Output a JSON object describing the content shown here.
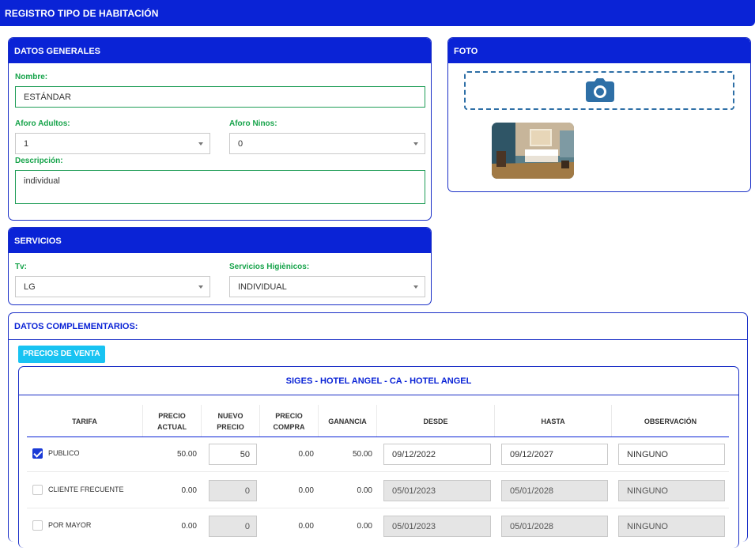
{
  "page_title": "REGISTRO TIPO DE HABITACIÓN",
  "datos_generales": {
    "title": "DATOS GENERALES",
    "nombre_label": "Nombre:",
    "nombre_value": "ESTÁNDAR",
    "aforo_adultos_label": "Aforo Adultos:",
    "aforo_adultos_value": "1",
    "aforo_ninos_label": "Aforo Ninos:",
    "aforo_ninos_value": "0",
    "descripcion_label": "Descripción:",
    "descripcion_value": "individual"
  },
  "foto": {
    "title": "FOTO",
    "upload_icon": "camera-icon",
    "thumbnail": "room-photo"
  },
  "servicios": {
    "title": "SERVICIOS",
    "tv_label": "Tv:",
    "tv_value": "LG",
    "higienicos_label": "Servicios Higiènicos:",
    "higienicos_value": "INDIVIDUAL"
  },
  "datos_complementarios": {
    "title": "DATOS COMPLEMENTARIOS:",
    "precios_button": "PRECIOS DE VENTA",
    "table_title": "SIGES - HOTEL ANGEL - CA - HOTEL ANGEL",
    "columns": {
      "tarifa": "TARIFA",
      "precio_actual": "PRECIO ACTUAL",
      "nuevo_precio": "NUEVO PRECIO",
      "precio_compra": "PRECIO COMPRA",
      "ganancia": "GANANCIA",
      "desde": "DESDE",
      "hasta": "HASTA",
      "observacion": "OBSERVACIÓN"
    },
    "rows": [
      {
        "checked": true,
        "tarifa": "PUBLICO",
        "precio_actual": "50.00",
        "nuevo_precio": "50",
        "precio_compra": "0.00",
        "ganancia": "50.00",
        "desde": "09/12/2022",
        "hasta": "09/12/2027",
        "observacion": "NINGUNO"
      },
      {
        "checked": false,
        "tarifa": "CLIENTE FRECUENTE",
        "precio_actual": "0.00",
        "nuevo_precio": "0",
        "precio_compra": "0.00",
        "ganancia": "0.00",
        "desde": "05/01/2023",
        "hasta": "05/01/2028",
        "observacion": "NINGUNO"
      },
      {
        "checked": false,
        "tarifa": "POR MAYOR",
        "precio_actual": "0.00",
        "nuevo_precio": "0",
        "precio_compra": "0.00",
        "ganancia": "0.00",
        "desde": "05/01/2023",
        "hasta": "05/01/2028",
        "observacion": "NINGUNO"
      }
    ]
  },
  "colors": {
    "primary": "#0a23d6",
    "label_green": "#16a34a",
    "accent_cyan": "#18c3f2"
  }
}
